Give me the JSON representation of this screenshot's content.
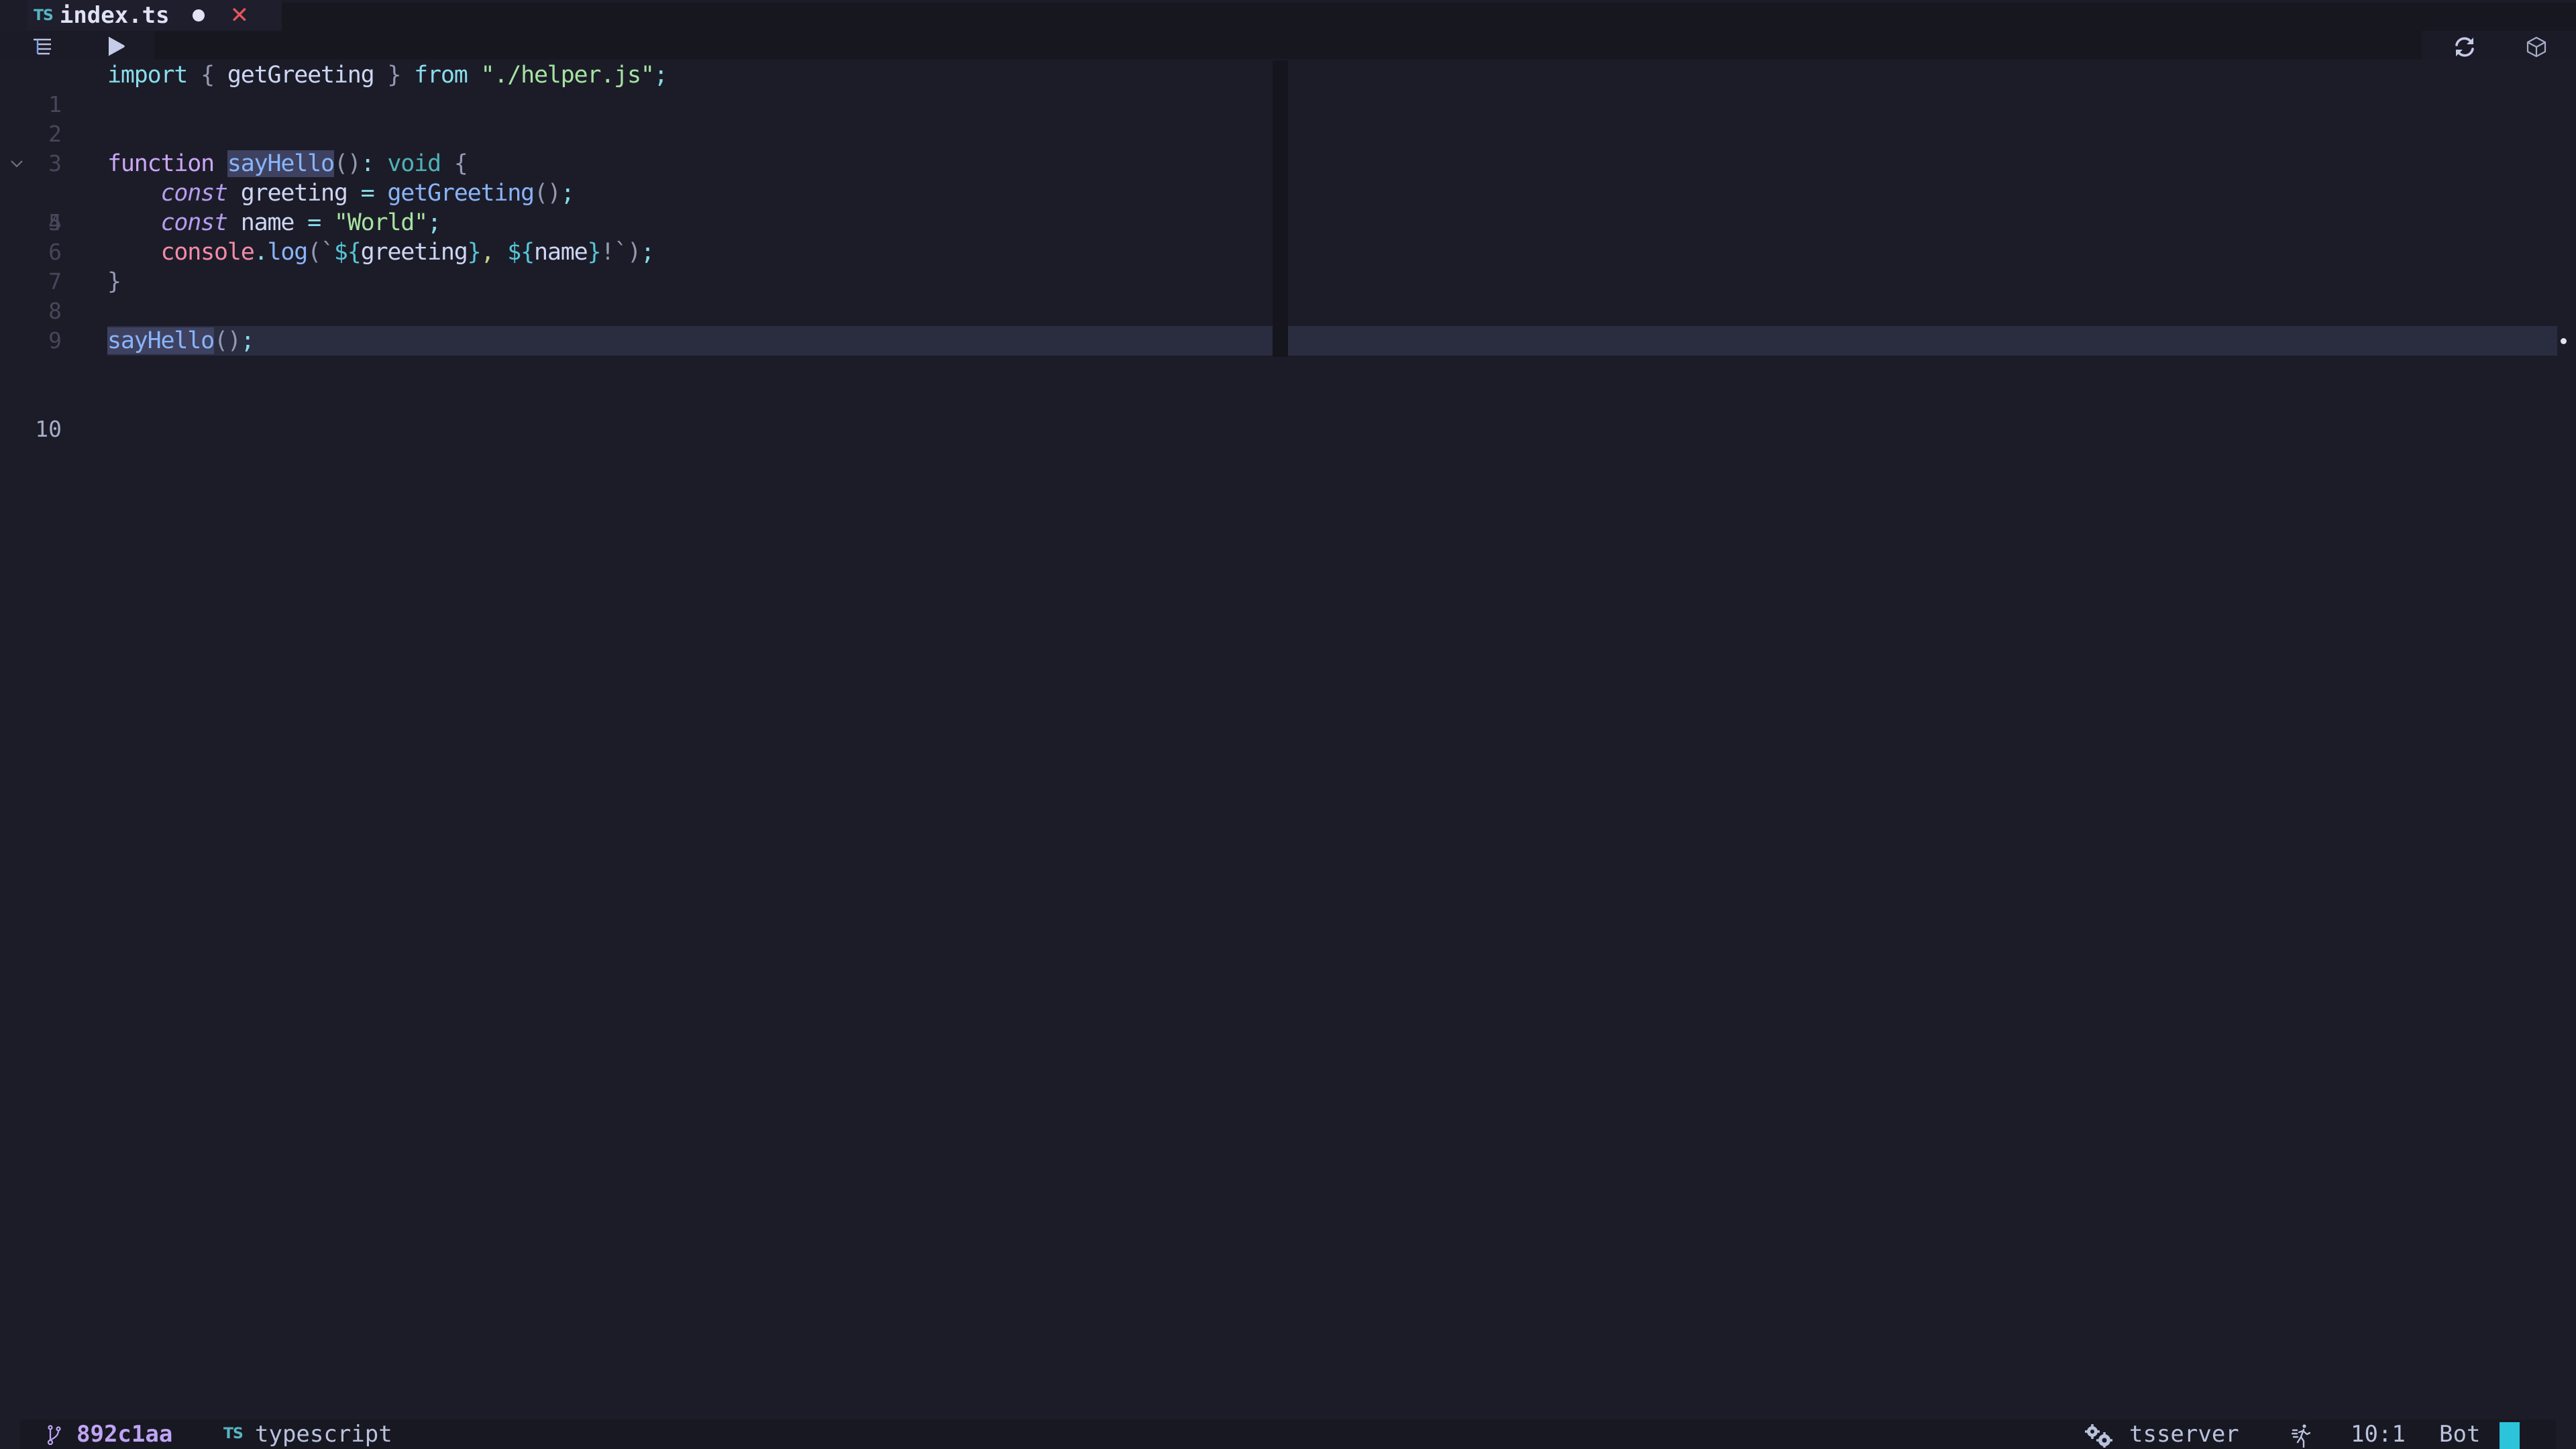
{
  "tab": {
    "filetype_icon": "TS",
    "title": "index.ts",
    "modified_indicator": "●",
    "close_label": "✕"
  },
  "winbar": {
    "icons": [
      "outline-icon",
      "run-icon",
      "refresh-icon",
      "cube-icon"
    ]
  },
  "editor": {
    "lines": [
      {
        "num": "1",
        "text": "import { getGreeting } from \"./helper.js\";"
      },
      {
        "num": "2",
        "text": ""
      },
      {
        "num": "3",
        "text": ""
      },
      {
        "num": "4",
        "text": "function sayHello(): void {",
        "foldable": true
      },
      {
        "num": "5",
        "text": "    const greeting = getGreeting();"
      },
      {
        "num": "6",
        "text": "    const name = \"World\";"
      },
      {
        "num": "7",
        "text": "    console.log(`${greeting}, ${name}!`);"
      },
      {
        "num": "8",
        "text": "}"
      },
      {
        "num": "9",
        "text": ""
      },
      {
        "num": "10",
        "text": "sayHello();",
        "current": true
      }
    ],
    "tokens": {
      "l1": [
        "import",
        " ",
        "{",
        " ",
        "getGreeting",
        " ",
        "}",
        " ",
        "from",
        " ",
        "\"./helper.js\"",
        ";"
      ],
      "l4": [
        "function",
        " ",
        "sayHello",
        "()",
        ":",
        " ",
        "void",
        " ",
        "{"
      ],
      "l5": [
        "    ",
        "const",
        " ",
        "greeting",
        " ",
        "=",
        " ",
        "getGreeting",
        "()",
        ";"
      ],
      "l6": [
        "    ",
        "const",
        " ",
        "name",
        " ",
        "=",
        " ",
        "\"World\"",
        ";"
      ],
      "l7": [
        "    ",
        "console",
        ".",
        "log",
        "(",
        "`",
        "${",
        "greeting",
        "}",
        ",",
        " ",
        "${",
        "name",
        "}",
        "!`",
        ")",
        ";"
      ],
      "l8": [
        "}"
      ],
      "l10": [
        "sayHello",
        "()",
        ";"
      ]
    },
    "fold_icon": "⌄"
  },
  "statusbar": {
    "branch": "892c1aa",
    "filetype_icon": "TS",
    "filetype": "typescript",
    "lsp": "tsserver",
    "position": "10:1",
    "scroll": "Bot"
  },
  "colors": {
    "background": "#1c1c28",
    "mode_indicator": "#2bc4db",
    "branch": "#c0a4f5",
    "close": "#e8555a"
  }
}
